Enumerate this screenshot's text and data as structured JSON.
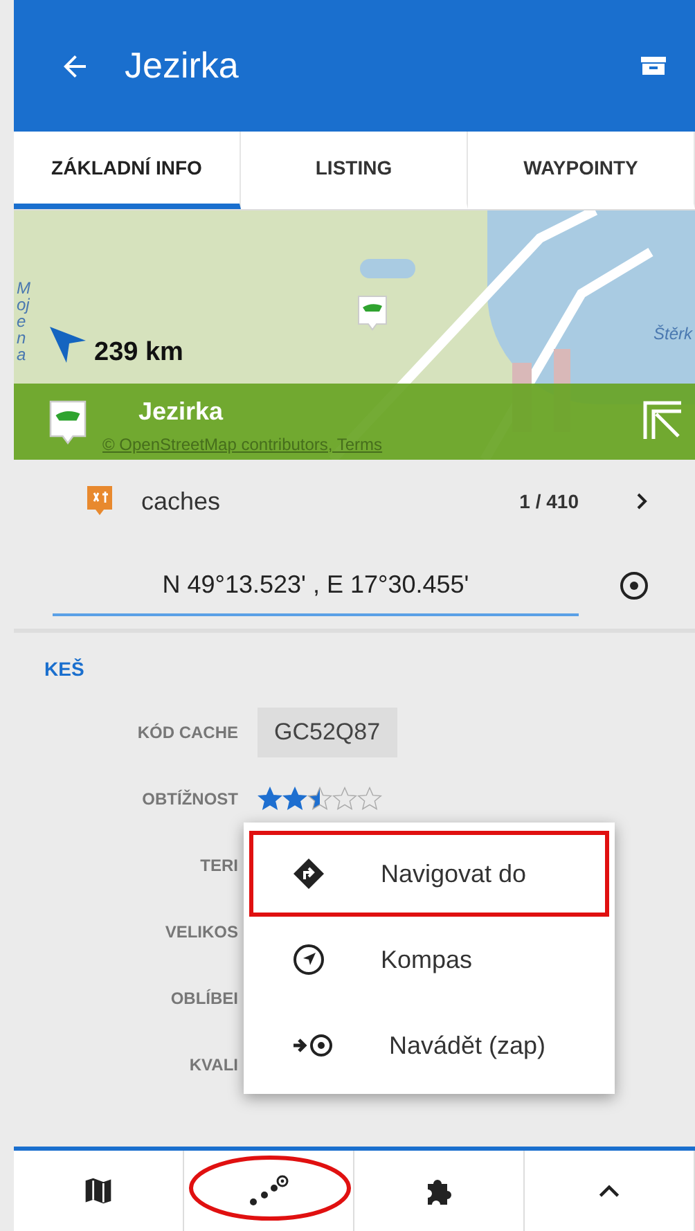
{
  "header": {
    "title": "Jezirka"
  },
  "tabs": [
    {
      "label": "ZÁKLADNÍ INFO",
      "selected": true
    },
    {
      "label": "LISTING",
      "selected": false
    },
    {
      "label": "WAYPOINTY",
      "selected": false
    }
  ],
  "map": {
    "labels": [
      "Mojena",
      "Štěrk"
    ],
    "distance": "239 km",
    "title": "Jezirka",
    "attribution": "© OpenStreetMap contributors, Terms"
  },
  "point_set": {
    "name": "caches",
    "count": "1 / 410"
  },
  "coordinates": {
    "value": "N 49°13.523' , E 17°30.455'"
  },
  "section": {
    "title": "KEŠ"
  },
  "fields": [
    {
      "kind": "code",
      "label": "KÓD CACHE",
      "value": "GC52Q87"
    },
    {
      "kind": "stars",
      "label": "OBTÍŽNOST",
      "stars": 2.5
    },
    {
      "kind": "label",
      "label": "TERI"
    },
    {
      "kind": "label",
      "label": "VELIKOS"
    },
    {
      "kind": "label",
      "label": "OBLÍBEI"
    },
    {
      "kind": "label",
      "label": "KVALI"
    }
  ],
  "menu": [
    {
      "label": "Navigovat do",
      "highlighted": true
    },
    {
      "label": "Kompas",
      "highlighted": false
    },
    {
      "label": "Navádět (zap)",
      "highlighted": false
    }
  ],
  "bottom_bar": [
    {
      "kind": "map",
      "circled": false
    },
    {
      "kind": "route",
      "circled": true
    },
    {
      "kind": "puzzle",
      "circled": false
    },
    {
      "kind": "up",
      "circled": false
    }
  ]
}
